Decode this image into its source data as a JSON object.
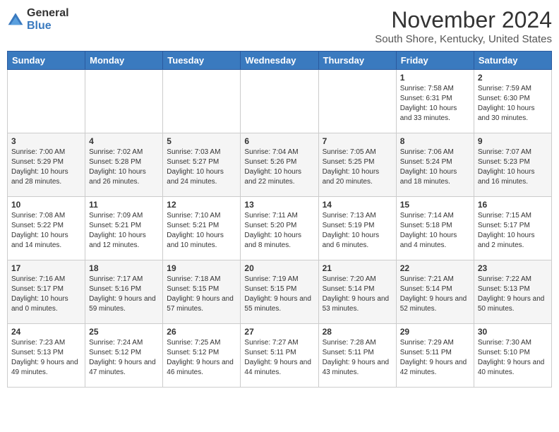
{
  "header": {
    "logo_general": "General",
    "logo_blue": "Blue",
    "month_year": "November 2024",
    "location": "South Shore, Kentucky, United States"
  },
  "weekdays": [
    "Sunday",
    "Monday",
    "Tuesday",
    "Wednesday",
    "Thursday",
    "Friday",
    "Saturday"
  ],
  "weeks": [
    [
      {
        "day": "",
        "info": ""
      },
      {
        "day": "",
        "info": ""
      },
      {
        "day": "",
        "info": ""
      },
      {
        "day": "",
        "info": ""
      },
      {
        "day": "",
        "info": ""
      },
      {
        "day": "1",
        "info": "Sunrise: 7:58 AM\nSunset: 6:31 PM\nDaylight: 10 hours\nand 33 minutes."
      },
      {
        "day": "2",
        "info": "Sunrise: 7:59 AM\nSunset: 6:30 PM\nDaylight: 10 hours\nand 30 minutes."
      }
    ],
    [
      {
        "day": "3",
        "info": "Sunrise: 7:00 AM\nSunset: 5:29 PM\nDaylight: 10 hours\nand 28 minutes."
      },
      {
        "day": "4",
        "info": "Sunrise: 7:02 AM\nSunset: 5:28 PM\nDaylight: 10 hours\nand 26 minutes."
      },
      {
        "day": "5",
        "info": "Sunrise: 7:03 AM\nSunset: 5:27 PM\nDaylight: 10 hours\nand 24 minutes."
      },
      {
        "day": "6",
        "info": "Sunrise: 7:04 AM\nSunset: 5:26 PM\nDaylight: 10 hours\nand 22 minutes."
      },
      {
        "day": "7",
        "info": "Sunrise: 7:05 AM\nSunset: 5:25 PM\nDaylight: 10 hours\nand 20 minutes."
      },
      {
        "day": "8",
        "info": "Sunrise: 7:06 AM\nSunset: 5:24 PM\nDaylight: 10 hours\nand 18 minutes."
      },
      {
        "day": "9",
        "info": "Sunrise: 7:07 AM\nSunset: 5:23 PM\nDaylight: 10 hours\nand 16 minutes."
      }
    ],
    [
      {
        "day": "10",
        "info": "Sunrise: 7:08 AM\nSunset: 5:22 PM\nDaylight: 10 hours\nand 14 minutes."
      },
      {
        "day": "11",
        "info": "Sunrise: 7:09 AM\nSunset: 5:21 PM\nDaylight: 10 hours\nand 12 minutes."
      },
      {
        "day": "12",
        "info": "Sunrise: 7:10 AM\nSunset: 5:21 PM\nDaylight: 10 hours\nand 10 minutes."
      },
      {
        "day": "13",
        "info": "Sunrise: 7:11 AM\nSunset: 5:20 PM\nDaylight: 10 hours\nand 8 minutes."
      },
      {
        "day": "14",
        "info": "Sunrise: 7:13 AM\nSunset: 5:19 PM\nDaylight: 10 hours\nand 6 minutes."
      },
      {
        "day": "15",
        "info": "Sunrise: 7:14 AM\nSunset: 5:18 PM\nDaylight: 10 hours\nand 4 minutes."
      },
      {
        "day": "16",
        "info": "Sunrise: 7:15 AM\nSunset: 5:17 PM\nDaylight: 10 hours\nand 2 minutes."
      }
    ],
    [
      {
        "day": "17",
        "info": "Sunrise: 7:16 AM\nSunset: 5:17 PM\nDaylight: 10 hours\nand 0 minutes."
      },
      {
        "day": "18",
        "info": "Sunrise: 7:17 AM\nSunset: 5:16 PM\nDaylight: 9 hours\nand 59 minutes."
      },
      {
        "day": "19",
        "info": "Sunrise: 7:18 AM\nSunset: 5:15 PM\nDaylight: 9 hours\nand 57 minutes."
      },
      {
        "day": "20",
        "info": "Sunrise: 7:19 AM\nSunset: 5:15 PM\nDaylight: 9 hours\nand 55 minutes."
      },
      {
        "day": "21",
        "info": "Sunrise: 7:20 AM\nSunset: 5:14 PM\nDaylight: 9 hours\nand 53 minutes."
      },
      {
        "day": "22",
        "info": "Sunrise: 7:21 AM\nSunset: 5:14 PM\nDaylight: 9 hours\nand 52 minutes."
      },
      {
        "day": "23",
        "info": "Sunrise: 7:22 AM\nSunset: 5:13 PM\nDaylight: 9 hours\nand 50 minutes."
      }
    ],
    [
      {
        "day": "24",
        "info": "Sunrise: 7:23 AM\nSunset: 5:13 PM\nDaylight: 9 hours\nand 49 minutes."
      },
      {
        "day": "25",
        "info": "Sunrise: 7:24 AM\nSunset: 5:12 PM\nDaylight: 9 hours\nand 47 minutes."
      },
      {
        "day": "26",
        "info": "Sunrise: 7:25 AM\nSunset: 5:12 PM\nDaylight: 9 hours\nand 46 minutes."
      },
      {
        "day": "27",
        "info": "Sunrise: 7:27 AM\nSunset: 5:11 PM\nDaylight: 9 hours\nand 44 minutes."
      },
      {
        "day": "28",
        "info": "Sunrise: 7:28 AM\nSunset: 5:11 PM\nDaylight: 9 hours\nand 43 minutes."
      },
      {
        "day": "29",
        "info": "Sunrise: 7:29 AM\nSunset: 5:11 PM\nDaylight: 9 hours\nand 42 minutes."
      },
      {
        "day": "30",
        "info": "Sunrise: 7:30 AM\nSunset: 5:10 PM\nDaylight: 9 hours\nand 40 minutes."
      }
    ]
  ]
}
